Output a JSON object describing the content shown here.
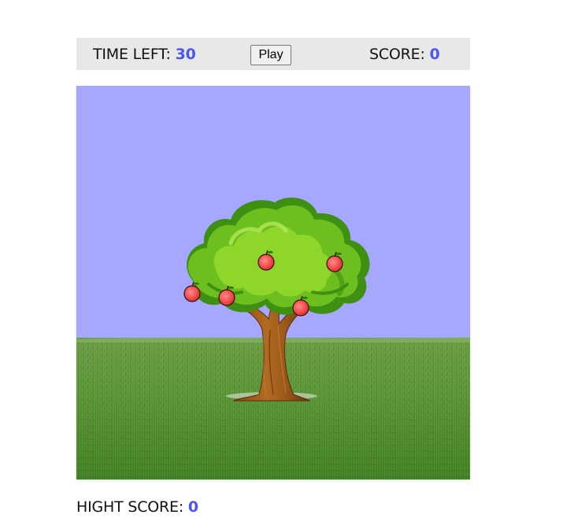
{
  "hud": {
    "time_label": "TIME LEFT:",
    "time_value": "30",
    "play_label": "Play",
    "score_label": "SCORE:",
    "score_value": "0"
  },
  "footer": {
    "high_score_label": "HIGHT SCORE:",
    "high_score_value": "0"
  },
  "scene": {
    "sky_color": "#a6a8ff",
    "grass_color": "#4f8a2a",
    "apple_color": "#f24a4a",
    "apple_count": 5
  },
  "colors": {
    "accent": "#4b55f0",
    "hud_background": "#e8e8e8"
  }
}
